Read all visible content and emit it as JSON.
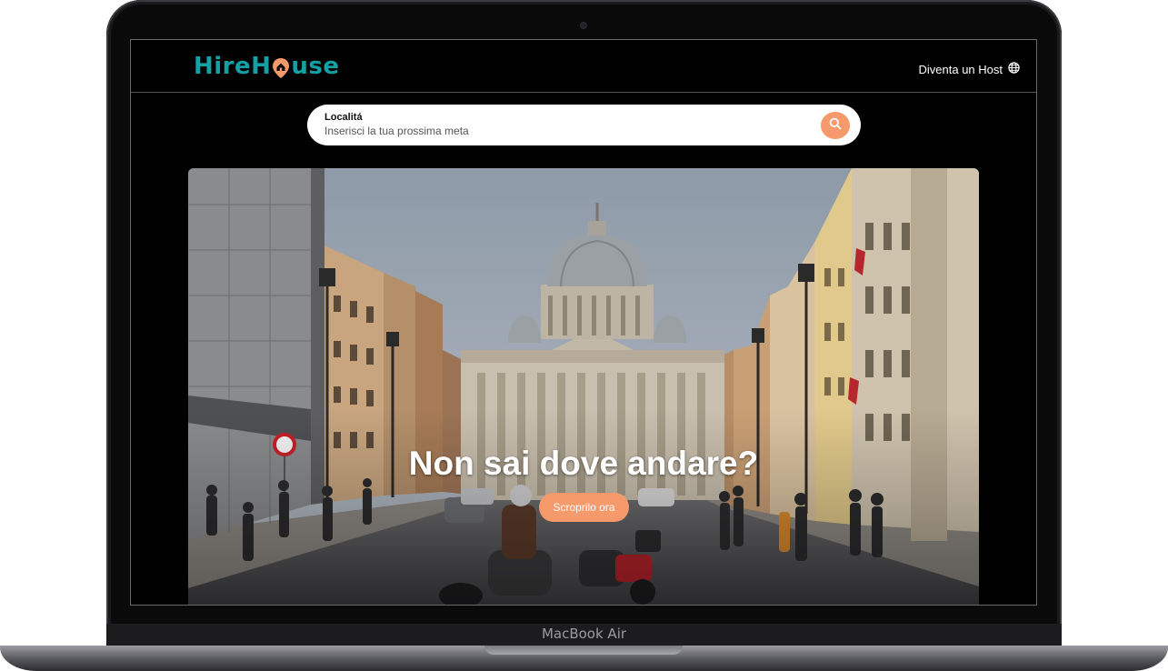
{
  "app": {
    "logo_text_left": "HireH",
    "logo_text_right": "use",
    "brand_color": "#13a1a6",
    "accent_color": "#f6996b"
  },
  "nav": {
    "host_link": "Diventa un Host",
    "host_icon": "globe-icon"
  },
  "search": {
    "label": "Localitá",
    "placeholder": "Inserisci la tua prossima meta",
    "value": "",
    "button_icon": "search-icon"
  },
  "hero": {
    "title": "Non sai dove andare?",
    "button_label": "Scroprilo ora"
  },
  "device": {
    "label": "MacBook Air"
  }
}
